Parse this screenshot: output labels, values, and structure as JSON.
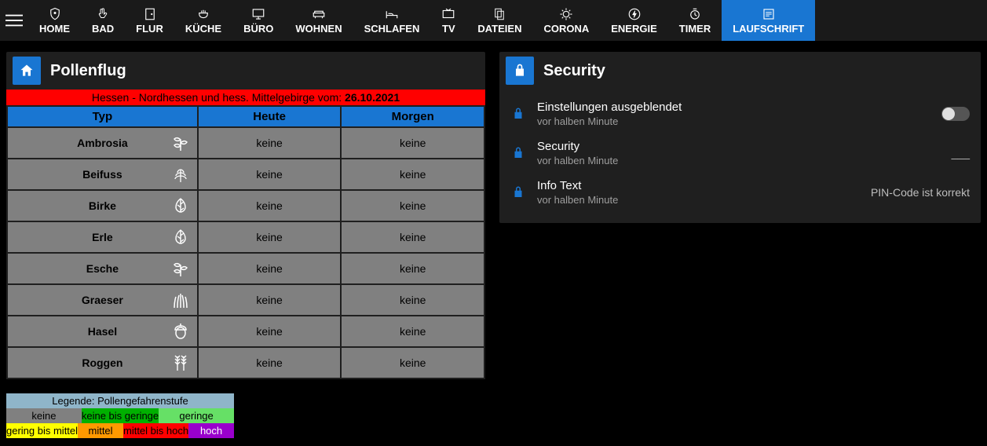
{
  "nav": [
    {
      "label": "HOME",
      "icon": "shield",
      "active": false
    },
    {
      "label": "BAD",
      "icon": "hand",
      "active": false
    },
    {
      "label": "FLUR",
      "icon": "door",
      "active": false
    },
    {
      "label": "KÜCHE",
      "icon": "pot",
      "active": false
    },
    {
      "label": "BÜRO",
      "icon": "desktop",
      "active": false
    },
    {
      "label": "WOHNEN",
      "icon": "sofa",
      "active": false
    },
    {
      "label": "SCHLAFEN",
      "icon": "bed",
      "active": false
    },
    {
      "label": "TV",
      "icon": "tv",
      "active": false
    },
    {
      "label": "DATEIEN",
      "icon": "files",
      "active": false
    },
    {
      "label": "CORONA",
      "icon": "virus",
      "active": false
    },
    {
      "label": "ENERGIE",
      "icon": "bolt",
      "active": false
    },
    {
      "label": "TIMER",
      "icon": "timer",
      "active": false
    },
    {
      "label": "LAUFSCHRIFT",
      "icon": "scroll",
      "active": true
    }
  ],
  "pollen": {
    "title": "Pollenflug",
    "banner_prefix": "Hessen - Nordhessen und hess. Mittelgebirge vom: ",
    "banner_date": "26.10.2021",
    "headers": {
      "typ": "Typ",
      "heute": "Heute",
      "morgen": "Morgen"
    },
    "rows": [
      {
        "name": "Ambrosia",
        "icon": "plant1",
        "heute": "keine",
        "morgen": "keine"
      },
      {
        "name": "Beifuss",
        "icon": "plant2",
        "heute": "keine",
        "morgen": "keine"
      },
      {
        "name": "Birke",
        "icon": "leaf",
        "heute": "keine",
        "morgen": "keine"
      },
      {
        "name": "Erle",
        "icon": "leaf",
        "heute": "keine",
        "morgen": "keine"
      },
      {
        "name": "Esche",
        "icon": "plant1",
        "heute": "keine",
        "morgen": "keine"
      },
      {
        "name": "Graeser",
        "icon": "grass",
        "heute": "keine",
        "morgen": "keine"
      },
      {
        "name": "Hasel",
        "icon": "nut",
        "heute": "keine",
        "morgen": "keine"
      },
      {
        "name": "Roggen",
        "icon": "wheat",
        "heute": "keine",
        "morgen": "keine"
      }
    ],
    "legend": {
      "title": "Legende: Pollengefahrenstufe",
      "row1": [
        {
          "label": "keine",
          "bg": "#808080"
        },
        {
          "label": "keine bis geringe",
          "bg": "#00b000"
        },
        {
          "label": "geringe",
          "bg": "#66e066"
        }
      ],
      "row2": [
        {
          "label": "gering bis mittel",
          "bg": "#ffff00"
        },
        {
          "label": "mittel",
          "bg": "#ff9900"
        },
        {
          "label": "mittel bis hoch",
          "bg": "#ff0000"
        },
        {
          "label": "hoch",
          "bg": "#9900cc",
          "fg": "#fff"
        }
      ]
    }
  },
  "security": {
    "title": "Security",
    "items": [
      {
        "title": "Einstellungen ausgeblendet",
        "sub": "vor halben Minute",
        "right_type": "toggle",
        "right_value": false
      },
      {
        "title": "Security",
        "sub": "vor halben Minute",
        "right_type": "text",
        "right_value": "___"
      },
      {
        "title": "Info Text",
        "sub": "vor halben Minute",
        "right_type": "text",
        "right_value": "PIN-Code ist korrekt"
      }
    ]
  }
}
